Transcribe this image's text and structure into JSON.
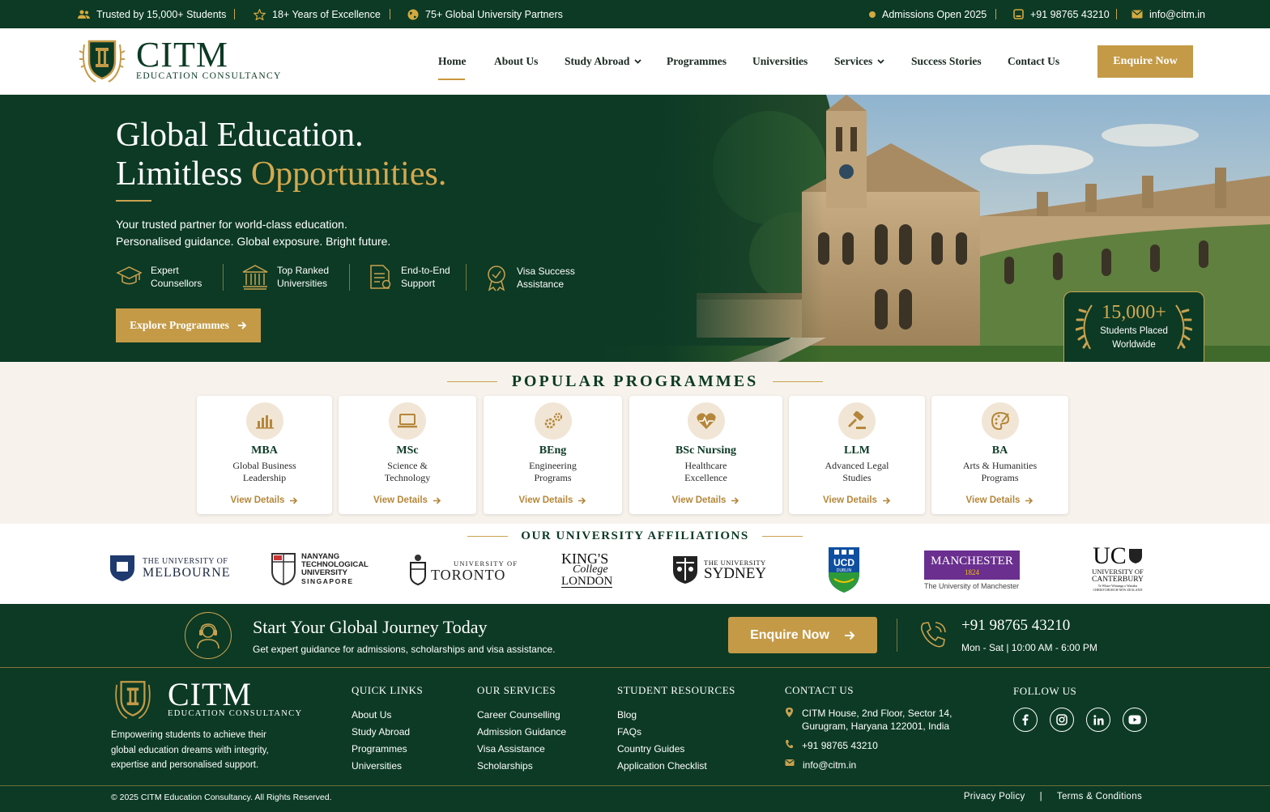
{
  "topbar": {
    "trusted": "Trusted by 15,000+ Students",
    "years": "18+ Years of Excellence",
    "partners": "75+ Global University Partners",
    "admissions": "Admissions Open 2025",
    "phone": "+91 98765 43210",
    "email": "info@citm.in"
  },
  "brand": {
    "name": "CITM",
    "tagline": "EDUCATION CONSULTANCY"
  },
  "nav": {
    "items": [
      {
        "label": "Home",
        "active": true
      },
      {
        "label": "About Us"
      },
      {
        "label": "Study Abroad",
        "dropdown": true
      },
      {
        "label": "Programmes"
      },
      {
        "label": "Universities"
      },
      {
        "label": "Services",
        "dropdown": true
      },
      {
        "label": "Success Stories"
      },
      {
        "label": "Contact Us"
      }
    ],
    "cta": "Enquire Now"
  },
  "hero": {
    "title_line1": "Global Education.",
    "title_line2_a": "Limitless ",
    "title_line2_b": "Opportunities.",
    "subtitle_line1": "Your trusted partner for world-class education.",
    "subtitle_line2": "Personalised guidance. Global exposure. Bright future.",
    "features": [
      {
        "line1": "Expert",
        "line2": "Counsellors",
        "icon": "graduation-cap-icon"
      },
      {
        "line1": "Top Ranked",
        "line2": "Universities",
        "icon": "university-building-icon"
      },
      {
        "line1": "End-to-End",
        "line2": "Support",
        "icon": "document-icon"
      },
      {
        "line1": "Visa Success",
        "line2": "Assistance",
        "icon": "award-badge-icon"
      }
    ],
    "button": "Explore Programmes",
    "stat_number": "15,000+",
    "stat_line1": "Students Placed",
    "stat_line2": "Worldwide"
  },
  "programmes": {
    "heading": "POPULAR PROGRAMMES",
    "link_label": "View Details",
    "items": [
      {
        "title": "MBA",
        "line1": "Global Business",
        "line2": "Leadership",
        "icon": "bar-chart-icon"
      },
      {
        "title": "MSc",
        "line1": "Science &",
        "line2": "Technology",
        "icon": "laptop-icon"
      },
      {
        "title": "BEng",
        "line1": "Engineering",
        "line2": "Programs",
        "icon": "gears-icon"
      },
      {
        "title": "BSc Nursing",
        "line1": "Healthcare",
        "line2": "Excellence",
        "icon": "heartbeat-icon"
      },
      {
        "title": "LLM",
        "line1": "Advanced Legal",
        "line2": "Studies",
        "icon": "gavel-icon"
      },
      {
        "title": "BA",
        "line1": "Arts & Humanities",
        "line2": "Programs",
        "icon": "palette-icon"
      }
    ]
  },
  "affiliations": {
    "heading": "OUR UNIVERSITY AFFILIATIONS",
    "melbourne": {
      "small": "THE UNIVERSITY OF",
      "big": "MELBOURNE"
    },
    "ntu": {
      "l1": "NANYANG",
      "l2": "TECHNOLOGICAL",
      "l3": "UNIVERSITY",
      "l4": "SINGAPORE"
    },
    "toronto": {
      "small": "UNIVERSITY OF",
      "big": "TORONTO"
    },
    "kings": {
      "l1": "KING'S",
      "l2": "College",
      "l3": "LONDON"
    },
    "sydney": {
      "small": "THE UNIVERSITY",
      "big": "SYDNEY"
    },
    "ucd": {
      "l1": "UCD",
      "l2": "DUBLIN"
    },
    "manchester": {
      "name": "MANCHESTER",
      "year": "1824",
      "sub": "The University of Manchester"
    },
    "canterbury": {
      "big": "UC",
      "l1": "UNIVERSITY OF",
      "l2": "CANTERBURY",
      "l3": "Te Whare Wānanga o Waitaha",
      "l4": "CHRISTCHURCH NEW ZEALAND"
    }
  },
  "cta": {
    "title": "Start Your Global Journey Today",
    "subtitle": "Get expert guidance for admissions, scholarships and visa assistance.",
    "button": "Enquire Now",
    "phone": "+91 98765 43210",
    "hours": "Mon - Sat | 10:00 AM - 6:00 PM"
  },
  "footer": {
    "description": "Empowering students to achieve their global education dreams with integrity, expertise and personalised support.",
    "quick_links": {
      "heading": "QUICK LINKS",
      "items": [
        "About Us",
        "Study Abroad",
        "Programmes",
        "Universities"
      ]
    },
    "services": {
      "heading": "OUR SERVICES",
      "items": [
        "Career Counselling",
        "Admission Guidance",
        "Visa Assistance",
        "Scholarships"
      ]
    },
    "resources": {
      "heading": "STUDENT RESOURCES",
      "items": [
        "Blog",
        "FAQs",
        "Country Guides",
        "Application Checklist"
      ]
    },
    "contact": {
      "heading": "CONTACT US",
      "address_line1": "CITM House, 2nd Floor, Sector 14,",
      "address_line2": "Gurugram, Haryana 122001, India",
      "phone": "+91 98765 43210",
      "email": "info@citm.in"
    },
    "follow": {
      "heading": "FOLLOW US",
      "icons": [
        "facebook-icon",
        "instagram-icon",
        "linkedin-icon",
        "youtube-icon"
      ]
    },
    "copyright": "© 2025 CITM Education Consultancy. All Rights Reserved.",
    "privacy": "Privacy Policy",
    "terms": "Terms & Conditions",
    "legal_sep": "|"
  },
  "colors": {
    "primary_green": "#0c3a25",
    "gold": "#c49a47",
    "cream": "#f7f3ec"
  }
}
